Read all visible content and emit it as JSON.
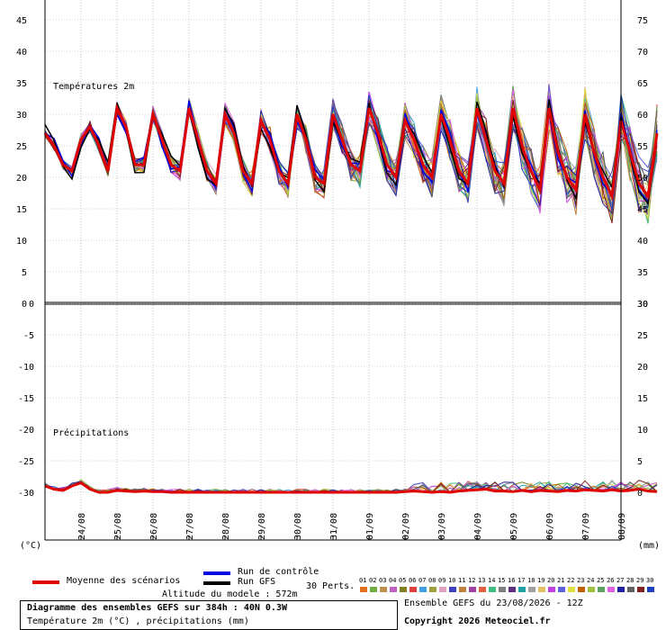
{
  "chart_data": [
    {
      "type": "line",
      "title": "Températures 2m",
      "left_axis": {
        "min": 0,
        "max": 45,
        "ticks": [
          0,
          5,
          10,
          15,
          20,
          25,
          30,
          35,
          40,
          45
        ]
      },
      "right_axis": {
        "min": 30,
        "max": 75,
        "ticks": [
          30,
          35,
          40,
          45,
          50,
          55,
          60,
          65,
          70,
          75
        ]
      },
      "x_dates": [
        "24/08",
        "25/08",
        "26/08",
        "27/08",
        "28/08",
        "29/08",
        "30/08",
        "31/08",
        "01/09",
        "02/09",
        "03/09",
        "04/09",
        "05/09",
        "06/09",
        "07/09",
        "08/09"
      ],
      "x_range_hours": [
        0,
        384
      ],
      "x_step_hours": 6,
      "mean": [
        27,
        25,
        22,
        21,
        26,
        28,
        25,
        21,
        31,
        28,
        22,
        22,
        30,
        26,
        22,
        21,
        31,
        26,
        21,
        19,
        30,
        27,
        21,
        19,
        29,
        26,
        21,
        19,
        30,
        26,
        20,
        19,
        30,
        26,
        22,
        21,
        31,
        27,
        22,
        20,
        29,
        26,
        22,
        20,
        30,
        26,
        21,
        19,
        31,
        26,
        21,
        19,
        31,
        25,
        21,
        18,
        31,
        24,
        20,
        18,
        30,
        24,
        20,
        17,
        29,
        24,
        19,
        17,
        27
      ]
    },
    {
      "type": "line",
      "title": "Précipitations",
      "left_axis": {
        "min": -30,
        "max": 0,
        "ticks": [
          0,
          -5,
          -10,
          -15,
          -20,
          -25,
          -30
        ]
      },
      "right_axis": {
        "min": 0,
        "max": 30,
        "ticks": [
          30,
          25,
          20,
          15,
          10,
          5,
          0
        ]
      },
      "mean": [
        1,
        0.5,
        0.3,
        1,
        1.5,
        0.5,
        0,
        0,
        0.3,
        0.2,
        0.1,
        0.2,
        0.1,
        0.1,
        0,
        0,
        0,
        0,
        0,
        0,
        0,
        0,
        0,
        0,
        0,
        0,
        0,
        0,
        0,
        0,
        0,
        0,
        0,
        0,
        0,
        0,
        0,
        0,
        0,
        0,
        0.1,
        0.2,
        0.1,
        0,
        0.1,
        0,
        0.2,
        0.3,
        0.4,
        0.5,
        0.2,
        0.2,
        0.1,
        0.3,
        0.1,
        0.3,
        0.2,
        0.1,
        0.3,
        0.2,
        0.4,
        0.3,
        0.2,
        0.4,
        0.2,
        0.3,
        0.5,
        0.2,
        0.1
      ]
    }
  ],
  "units": {
    "left": "(°C)",
    "right": "(mm)"
  },
  "colors": {
    "mean": "#e00000",
    "control": "#0000e0",
    "gfs": "#000000"
  },
  "pert_colors": [
    "#e07020",
    "#70b040",
    "#c09050",
    "#c060c0",
    "#808020",
    "#e04040",
    "#40a0e0",
    "#a0a040",
    "#e0a0c0",
    "#4040c0",
    "#c08040",
    "#a040a0",
    "#e06040",
    "#40c080",
    "#808080",
    "#603080",
    "#20a0a0",
    "#a0a0a0",
    "#e0c060",
    "#c040e0",
    "#6060e0",
    "#e0e040",
    "#c06000",
    "#a0c040",
    "#60a060",
    "#e060e0",
    "#2020a0",
    "#606060",
    "#802020",
    "#2040c0"
  ],
  "legend": {
    "mean": "Moyenne des scénarios",
    "control": "Run de contrôle",
    "gfs": "Run GFS",
    "perts": "30 Perts.",
    "pert_numbers": [
      "01",
      "02",
      "03",
      "04",
      "05",
      "06",
      "07",
      "08",
      "09",
      "10",
      "11",
      "12",
      "13",
      "14",
      "15",
      "16",
      "17",
      "18",
      "19",
      "20",
      "21",
      "22",
      "23",
      "24",
      "25",
      "26",
      "27",
      "28",
      "29",
      "30"
    ]
  },
  "footer": {
    "altitude": "Altitude du modele : 572m",
    "title": "Diagramme des ensembles GEFS sur 384h : 40N 0.3W",
    "subtitle": "Température 2m (°C) , précipitations (mm)",
    "run": "Ensemble GEFS du 23/08/2026 - 12Z",
    "copyright": "Copyright 2026 Meteociel.fr"
  }
}
